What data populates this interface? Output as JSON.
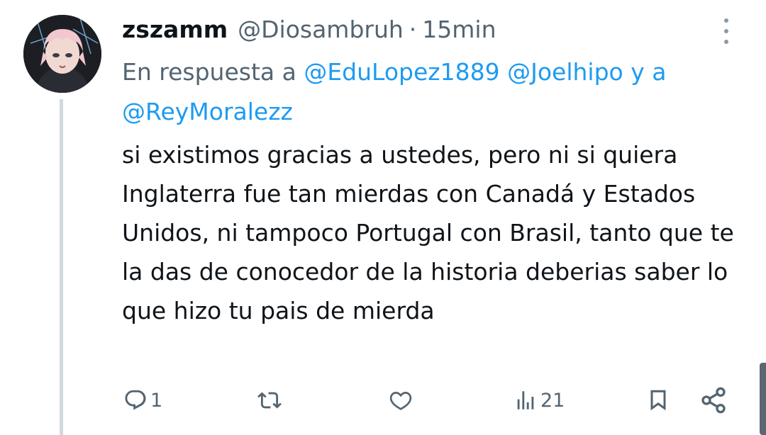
{
  "tweet": {
    "display_name": "zszamm",
    "handle": "@Diosambruh",
    "separator": "·",
    "time": "15min",
    "reply_prefix": "En respuesta a",
    "mentions": [
      "@EduLopez1889",
      "@Joelhipo"
    ],
    "reply_joiner": "y a",
    "mention_last": "@ReyMoralezz",
    "body": "si existimos gracias a ustedes, pero ni si quiera Inglaterra fue tan mierdas con Canadá y Estados Unidos, ni tampoco Portugal con Brasil, tanto que te la das de conocedor de la historia deberias saber lo que hizo tu pais de mierda",
    "actions": {
      "reply_count": "1",
      "retweet_count": "",
      "like_count": "",
      "views_count": "21"
    }
  },
  "colors": {
    "text": "#0f1419",
    "secondary": "#536471",
    "link": "#1d9bf0",
    "thread_line": "#cfd9de"
  },
  "icons": [
    "more-vertical-icon",
    "reply-icon",
    "retweet-icon",
    "like-icon",
    "views-icon",
    "bookmark-icon",
    "share-icon"
  ]
}
